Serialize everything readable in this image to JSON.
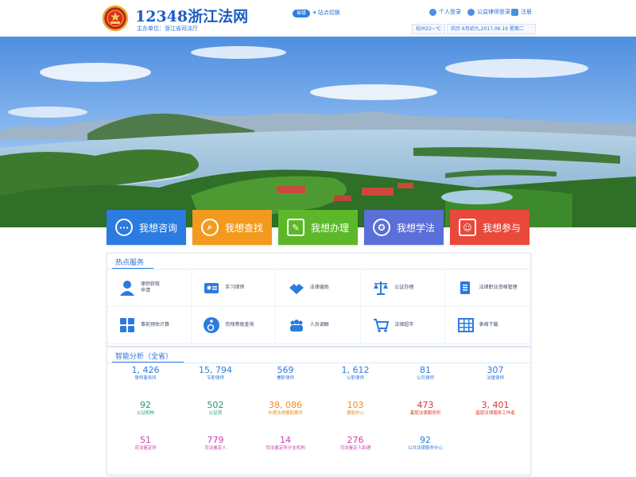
{
  "header": {
    "site_title": "12348浙江法网",
    "sponsor": "主办单位：浙江省司法厅",
    "city": "省级",
    "switch_site": "站点切换",
    "links": [
      "个人登录",
      "公益律师登录",
      "注册"
    ],
    "weather": "杭州22~℃",
    "date": "农历 6月初九,2017.06.19 星期二"
  },
  "services": [
    {
      "label": "我想咨询",
      "color": "#2b7be0",
      "icon": "chat-icon",
      "glyph": "···"
    },
    {
      "label": "我想查找",
      "color": "#f39a1e",
      "icon": "magnifier-icon",
      "glyph": "⌕"
    },
    {
      "label": "我想办理",
      "color": "#5cb82a",
      "icon": "edit-icon",
      "glyph": "✎"
    },
    {
      "label": "我想学法",
      "color": "#5a6fd8",
      "icon": "medal-icon",
      "glyph": "✪"
    },
    {
      "label": "我想参与",
      "color": "#e8493a",
      "icon": "people-icon",
      "glyph": "☺"
    }
  ],
  "hot": {
    "title": "热点服务",
    "items": [
      {
        "label": "律师获取\n申请",
        "icon": "lawyer-icon"
      },
      {
        "label": "实习律师",
        "icon": "id-card-icon"
      },
      {
        "label": "法律援助",
        "icon": "handshake-icon"
      },
      {
        "label": "公证办理",
        "icon": "scales-icon"
      },
      {
        "label": "法律职业资格管理",
        "icon": "document-icon"
      },
      {
        "label": "事前预估计算",
        "icon": "grid-icon"
      },
      {
        "label": "伤残等级查询",
        "icon": "wheelchair-icon"
      },
      {
        "label": "人员调解",
        "icon": "group-icon"
      },
      {
        "label": "法律超市",
        "icon": "cart-icon"
      },
      {
        "label": "表格下载",
        "icon": "table-icon"
      }
    ]
  },
  "analysis": {
    "title": "智能分析（全省）",
    "stats": [
      {
        "value": "1, 426",
        "label": "律师事务所",
        "color": "#2b7be0"
      },
      {
        "value": "15, 794",
        "label": "专职律师",
        "color": "#2b7be0"
      },
      {
        "value": "569",
        "label": "兼职律师",
        "color": "#2b7be0"
      },
      {
        "value": "1, 612",
        "label": "公职律师",
        "color": "#2b7be0"
      },
      {
        "value": "81",
        "label": "公司律师",
        "color": "#2b7be0"
      },
      {
        "value": "307",
        "label": "法援律师",
        "color": "#2b7be0"
      },
      {
        "value": "92",
        "label": "公证机构",
        "color": "#1f9a6a"
      },
      {
        "value": "502",
        "label": "公证员",
        "color": "#1f9a6a"
      },
      {
        "value": "38, 086",
        "label": "办理法律援助案件",
        "color": "#f08a1c"
      },
      {
        "value": "103",
        "label": "援助中心",
        "color": "#f08a1c"
      },
      {
        "value": "473",
        "label": "基层法律服务所",
        "color": "#d8392b"
      },
      {
        "value": "3, 401",
        "label": "基层法律服务工作者",
        "color": "#d8392b"
      },
      {
        "value": "51",
        "label": "司法鉴定所",
        "color": "#d23fb0"
      },
      {
        "value": "779",
        "label": "司法鉴定人",
        "color": "#d23fb0"
      },
      {
        "value": "14",
        "label": "司法鉴定所分支机构",
        "color": "#d23fb0"
      },
      {
        "value": "276",
        "label": "司法鉴定人助理",
        "color": "#d23fb0"
      },
      {
        "value": "92",
        "label": "公共法律服务中心",
        "color": "#2b7be0"
      }
    ]
  }
}
